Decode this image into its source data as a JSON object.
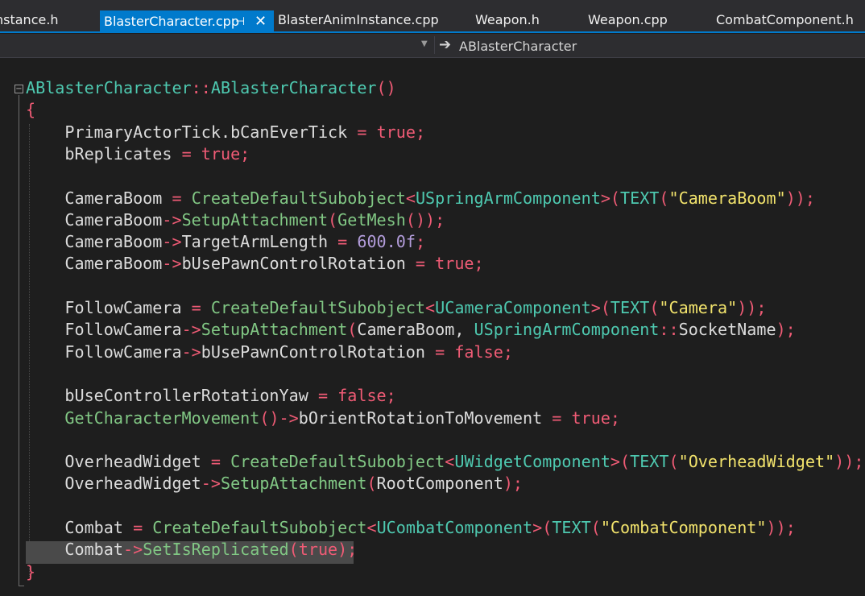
{
  "tabs": [
    {
      "label": "nstance.h",
      "active": false
    },
    {
      "label": "BlasterCharacter.cpp",
      "active": true
    },
    {
      "label": "BlasterAnimInstance.cpp",
      "active": false
    },
    {
      "label": "Weapon.h",
      "active": false
    },
    {
      "label": "Weapon.cpp",
      "active": false
    },
    {
      "label": "CombatComponent.h",
      "active": false
    }
  ],
  "tab_icons": {
    "pin": "pin-icon",
    "close": "close-icon"
  },
  "navbar": {
    "member_label": "ABlasterCharacter",
    "icons": [
      "chevron-down-icon",
      "arrow-right-icon"
    ]
  },
  "colors": {
    "accent": "#007acc",
    "type": "#4ec9b0",
    "function": "#81c784",
    "keyword": "#ef5b75",
    "string": "#f2e36c",
    "number": "#b39ddb",
    "text": "#dcdcdc"
  },
  "code": {
    "lines": [
      [
        [
          "cls",
          "ABlasterCharacter"
        ],
        [
          "op",
          "::"
        ],
        [
          "cls",
          "ABlasterCharacter"
        ],
        [
          "op",
          "()"
        ]
      ],
      [
        [
          "brace",
          "{"
        ]
      ],
      [
        [
          "id",
          "    PrimaryActorTick"
        ],
        [
          "punc",
          "."
        ],
        [
          "id",
          "bCanEverTick "
        ],
        [
          "op",
          "="
        ],
        [
          "punc",
          " "
        ],
        [
          "kw",
          "true"
        ],
        [
          "op",
          ";"
        ]
      ],
      [
        [
          "id",
          "    bReplicates "
        ],
        [
          "op",
          "="
        ],
        [
          "punc",
          " "
        ],
        [
          "kw",
          "true"
        ],
        [
          "op",
          ";"
        ]
      ],
      [],
      [
        [
          "id",
          "    CameraBoom "
        ],
        [
          "op",
          "="
        ],
        [
          "punc",
          " "
        ],
        [
          "fn",
          "CreateDefaultSubobject"
        ],
        [
          "op",
          "<"
        ],
        [
          "cls",
          "USpringArmComponent"
        ],
        [
          "op",
          ">("
        ],
        [
          "cls",
          "TEXT"
        ],
        [
          "op",
          "("
        ],
        [
          "str",
          "\"CameraBoom\""
        ],
        [
          "op",
          "));"
        ]
      ],
      [
        [
          "id",
          "    CameraBoom"
        ],
        [
          "op",
          "->"
        ],
        [
          "fn",
          "SetupAttachment"
        ],
        [
          "op",
          "("
        ],
        [
          "fn",
          "GetMesh"
        ],
        [
          "op",
          "());"
        ]
      ],
      [
        [
          "id",
          "    CameraBoom"
        ],
        [
          "op",
          "->"
        ],
        [
          "id",
          "TargetArmLength "
        ],
        [
          "op",
          "="
        ],
        [
          "punc",
          " "
        ],
        [
          "num",
          "600.0f"
        ],
        [
          "op",
          ";"
        ]
      ],
      [
        [
          "id",
          "    CameraBoom"
        ],
        [
          "op",
          "->"
        ],
        [
          "id",
          "bUsePawnControlRotation "
        ],
        [
          "op",
          "="
        ],
        [
          "punc",
          " "
        ],
        [
          "kw",
          "true"
        ],
        [
          "op",
          ";"
        ]
      ],
      [],
      [
        [
          "id",
          "    FollowCamera "
        ],
        [
          "op",
          "="
        ],
        [
          "punc",
          " "
        ],
        [
          "fn",
          "CreateDefaultSubobject"
        ],
        [
          "op",
          "<"
        ],
        [
          "cls",
          "UCameraComponent"
        ],
        [
          "op",
          ">("
        ],
        [
          "cls",
          "TEXT"
        ],
        [
          "op",
          "("
        ],
        [
          "str",
          "\"Camera\""
        ],
        [
          "op",
          "));"
        ]
      ],
      [
        [
          "id",
          "    FollowCamera"
        ],
        [
          "op",
          "->"
        ],
        [
          "fn",
          "SetupAttachment"
        ],
        [
          "op",
          "("
        ],
        [
          "id",
          "CameraBoom"
        ],
        [
          "punc",
          ", "
        ],
        [
          "cls",
          "USpringArmComponent"
        ],
        [
          "op",
          "::"
        ],
        [
          "id",
          "SocketName"
        ],
        [
          "op",
          ");"
        ]
      ],
      [
        [
          "id",
          "    FollowCamera"
        ],
        [
          "op",
          "->"
        ],
        [
          "id",
          "bUsePawnControlRotation "
        ],
        [
          "op",
          "="
        ],
        [
          "punc",
          " "
        ],
        [
          "kw",
          "false"
        ],
        [
          "op",
          ";"
        ]
      ],
      [],
      [
        [
          "id",
          "    bUseControllerRotationYaw "
        ],
        [
          "op",
          "="
        ],
        [
          "punc",
          " "
        ],
        [
          "kw",
          "false"
        ],
        [
          "op",
          ";"
        ]
      ],
      [
        [
          "punc",
          "    "
        ],
        [
          "fn",
          "GetCharacterMovement"
        ],
        [
          "op",
          "()->"
        ],
        [
          "id",
          "bOrientRotationToMovement "
        ],
        [
          "op",
          "="
        ],
        [
          "punc",
          " "
        ],
        [
          "kw",
          "true"
        ],
        [
          "op",
          ";"
        ]
      ],
      [],
      [
        [
          "id",
          "    OverheadWidget "
        ],
        [
          "op",
          "="
        ],
        [
          "punc",
          " "
        ],
        [
          "fn",
          "CreateDefaultSubobject"
        ],
        [
          "op",
          "<"
        ],
        [
          "cls",
          "UWidgetComponent"
        ],
        [
          "op",
          ">("
        ],
        [
          "cls",
          "TEXT"
        ],
        [
          "op",
          "("
        ],
        [
          "str",
          "\"OverheadWidget\""
        ],
        [
          "op",
          "));"
        ]
      ],
      [
        [
          "id",
          "    OverheadWidget"
        ],
        [
          "op",
          "->"
        ],
        [
          "fn",
          "SetupAttachment"
        ],
        [
          "op",
          "("
        ],
        [
          "id",
          "RootComponent"
        ],
        [
          "op",
          ");"
        ]
      ],
      [],
      [
        [
          "id",
          "    Combat "
        ],
        [
          "op",
          "="
        ],
        [
          "punc",
          " "
        ],
        [
          "fn",
          "CreateDefaultSubobject"
        ],
        [
          "op",
          "<"
        ],
        [
          "cls",
          "UCombatComponent"
        ],
        [
          "op",
          ">("
        ],
        [
          "cls",
          "TEXT"
        ],
        [
          "op",
          "("
        ],
        [
          "str",
          "\"CombatComponent\""
        ],
        [
          "op",
          "));"
        ]
      ],
      [
        [
          "id",
          "    Combat"
        ],
        [
          "op",
          "->"
        ],
        [
          "fn",
          "SetIsReplicated"
        ],
        [
          "op",
          "("
        ],
        [
          "kw",
          "true"
        ],
        [
          "op",
          ");"
        ]
      ],
      [
        [
          "brace",
          "}"
        ]
      ]
    ]
  }
}
